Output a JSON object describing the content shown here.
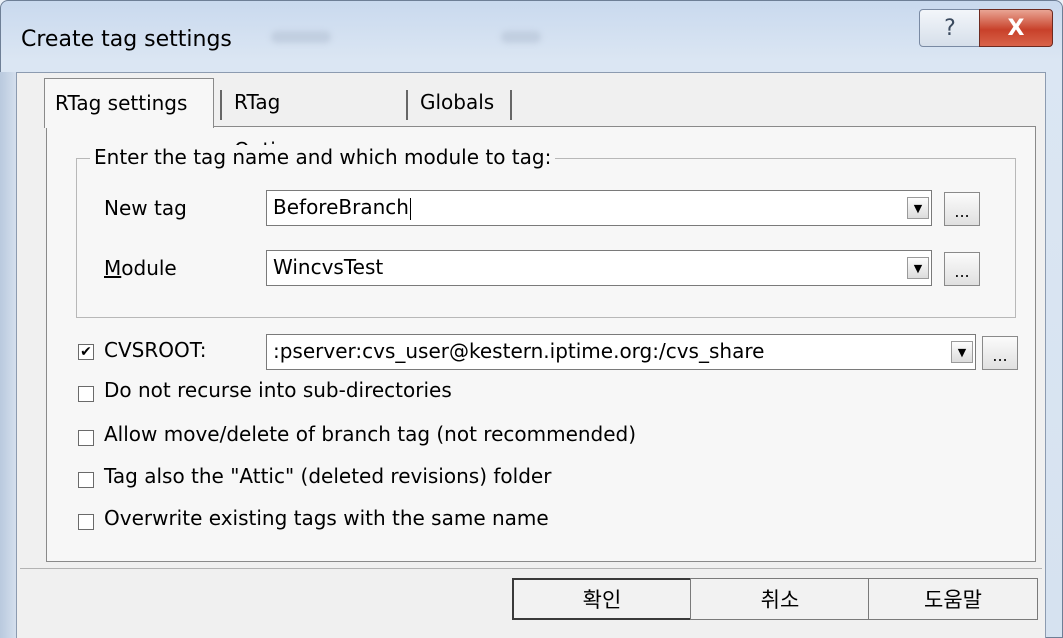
{
  "window": {
    "title": "Create tag settings",
    "help_glyph": "?",
    "close_glyph": "X"
  },
  "tabs": [
    {
      "label": "RTag settings",
      "active": true
    },
    {
      "label": "RTag Options",
      "active": false
    },
    {
      "label": "Globals",
      "active": false
    }
  ],
  "group": {
    "legend": "Enter the tag name and which module to tag:",
    "new_tag": {
      "label": "New tag",
      "value": "BeforeBranch"
    },
    "module": {
      "label": "Module",
      "value": "WincvsTest"
    }
  },
  "cvsroot": {
    "label": "CVSROOT:",
    "checked": true,
    "value": ":pserver:cvs_user@kestern.iptime.org:/cvs_share"
  },
  "options": [
    {
      "label": "Do not recurse into sub-directories",
      "checked": false
    },
    {
      "label": "Allow move/delete of branch tag (not recommended)",
      "checked": false
    },
    {
      "label": "Tag also the \"Attic\" (deleted revisions) folder",
      "checked": false
    },
    {
      "label": "Overwrite existing tags with the same name",
      "checked": false
    }
  ],
  "browse_label": "...",
  "buttons": {
    "ok": "확인",
    "cancel": "취소",
    "help": "도움말"
  }
}
